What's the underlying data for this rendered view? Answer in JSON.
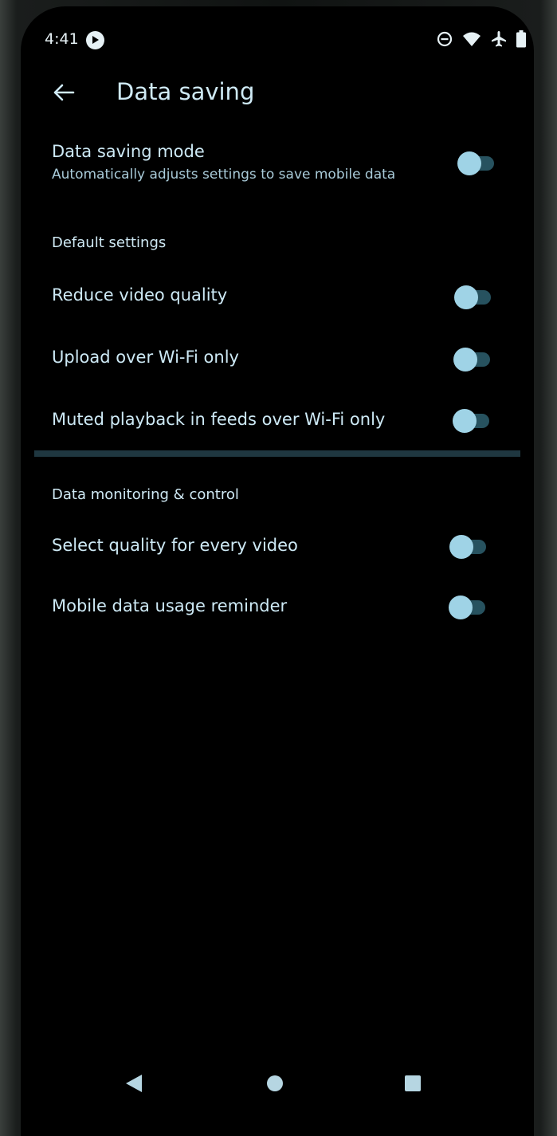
{
  "status_bar": {
    "time": "4:41",
    "icons": [
      "media-playing-icon",
      "do-not-disturb-icon",
      "wifi-icon",
      "airplane-mode-icon",
      "battery-icon"
    ]
  },
  "app_bar": {
    "back_icon": "arrow-back-icon",
    "title": "Data saving"
  },
  "data_saving_mode": {
    "title": "Data saving mode",
    "subtitle": "Automatically adjusts settings to save mobile data",
    "enabled": false
  },
  "default_settings": {
    "header": "Default settings",
    "items": [
      {
        "label": "Reduce video quality",
        "enabled": false
      },
      {
        "label": "Upload over Wi-Fi only",
        "enabled": false
      },
      {
        "label": "Muted playback in feeds over Wi-Fi only",
        "enabled": false
      }
    ]
  },
  "data_monitoring": {
    "header": "Data monitoring & control",
    "items": [
      {
        "label": "Select quality for every video",
        "enabled": false
      },
      {
        "label": "Mobile data usage reminder",
        "enabled": false
      }
    ]
  },
  "nav_bar": {
    "icons": [
      "nav-back-icon",
      "nav-home-icon",
      "nav-recents-icon"
    ]
  },
  "colors": {
    "background": "#000000",
    "text_primary": "#cde9f5",
    "text_secondary": "#a9cbd9",
    "toggle_thumb": "#9fd3e6",
    "toggle_track": "#27525f",
    "divider": "#1f3740"
  }
}
